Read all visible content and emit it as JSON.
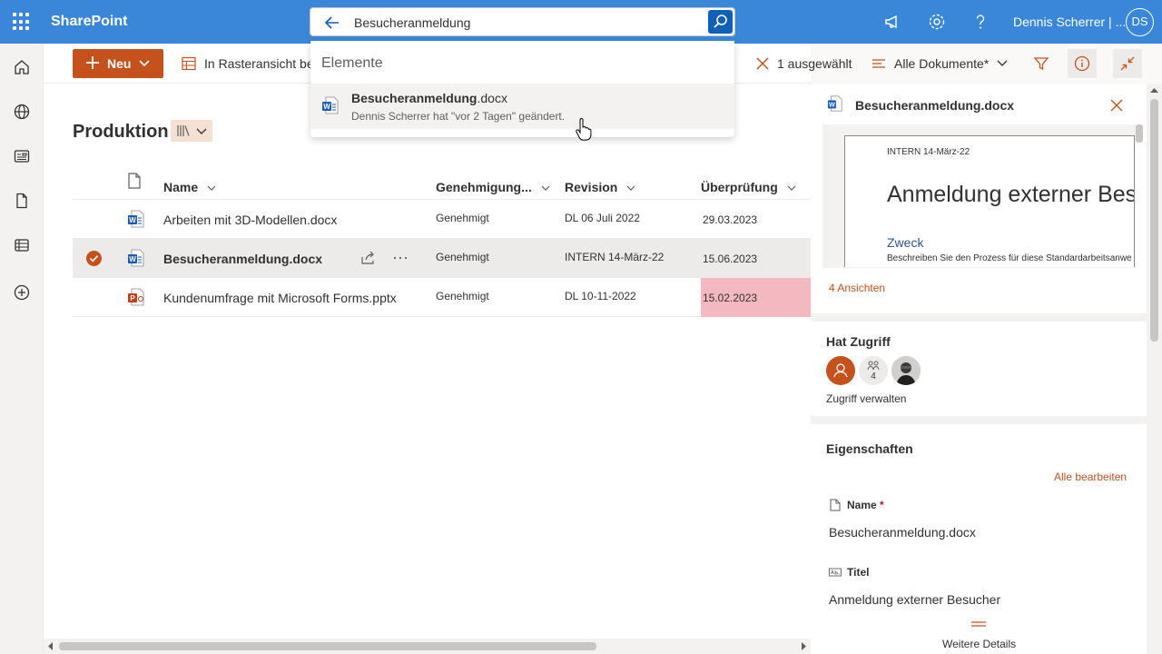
{
  "app": {
    "name": "SharePoint"
  },
  "search": {
    "value": "Besucheranmeldung",
    "placeholder": ""
  },
  "user": {
    "display_name": "Dennis Scherrer | ...",
    "initials": "DS"
  },
  "commandbar": {
    "new_label": "Neu",
    "grid_view_label": "In Rasteransicht be",
    "selected_label": "1 ausgewählt",
    "view_label": "Alle Dokumente*"
  },
  "library": {
    "title": "Produktion"
  },
  "columns": {
    "name": "Name",
    "approval": "Genehmigung...",
    "revision": "Revision",
    "review": "Überprüfung"
  },
  "rows": [
    {
      "name": "Arbeiten mit 3D-Modellen.docx",
      "type": "word",
      "approval": "Genehmigt",
      "revision": "DL 06 Juli 2022",
      "review": "29.03.2023",
      "selected": false,
      "overdue": false
    },
    {
      "name": "Besucheranmeldung.docx",
      "type": "word",
      "approval": "Genehmigt",
      "revision": "INTERN 14-März-22",
      "review": "15.06.2023",
      "selected": true,
      "overdue": false
    },
    {
      "name": "Kundenumfrage mit Microsoft Forms.pptx",
      "type": "powerpoint",
      "approval": "Genehmigt",
      "revision": "DL 10-11-2022",
      "review": "15.02.2023",
      "selected": false,
      "overdue": true
    }
  ],
  "dropdown": {
    "heading": "Elemente",
    "item": {
      "name_bold": "Besucheranmeldung",
      "name_ext": ".docx",
      "subtitle": "Dennis Scherrer hat \"vor 2 Tagen\" geändert."
    }
  },
  "panel": {
    "title": "Besucheranmeldung.docx",
    "preview": {
      "header": "INTERN 14-März-22",
      "heading": "Anmeldung externer Besu",
      "section": "Zweck",
      "body": "Beschreiben Sie den Prozess für diese Standardarbeitsanwe"
    },
    "views": "4 Ansichten",
    "access_title": "Hat Zugriff",
    "access_count": "4",
    "manage_access": "Zugriff verwalten",
    "properties_title": "Eigenschaften",
    "edit_all": "Alle bearbeiten",
    "name_label": "Name",
    "required_mark": "*",
    "name_value": "Besucheranmeldung.docx",
    "title_label": "Titel",
    "title_value": "Anmeldung externer Besucher",
    "more_details": "Weitere Details"
  },
  "icons": {
    "waffle": "waffle-icon",
    "back": "arrow-left-icon",
    "search": "search-icon",
    "megaphone": "megaphone-icon",
    "settings": "gear-icon",
    "help": "question-icon",
    "home": "home-icon",
    "globe": "globe-icon",
    "news": "news-icon",
    "document": "document-icon",
    "list": "list-icon",
    "add": "add-circle-icon",
    "filter": "filter-icon",
    "info": "info-icon",
    "collapse": "collapse-icon"
  },
  "colors": {
    "suitebar": "#3a86d8",
    "accent": "#c5511c",
    "overdue": "#f4b9c0",
    "word": "#185abd",
    "powerpoint": "#c43e1c"
  }
}
